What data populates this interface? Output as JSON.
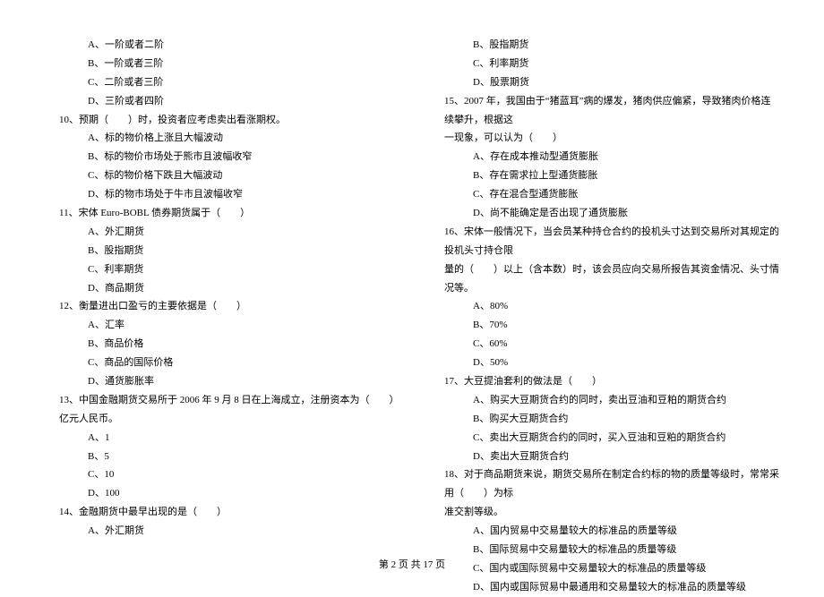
{
  "left": {
    "q9_opts": {
      "A": "A、一阶或者二阶",
      "B": "B、一阶或者三阶",
      "C": "C、二阶或者三阶",
      "D": "D、三阶或者四阶"
    },
    "q10": "10、预期（　　）时，投资者应考虑卖出看涨期权。",
    "q10_opts": {
      "A": "A、标的物价格上涨且大幅波动",
      "B": "B、标的物价市场处于熊市且波幅收窄",
      "C": "C、标的物价格下跌且大幅波动",
      "D": "D、标的物市场处于牛市且波幅收窄"
    },
    "q11": "11、宋体 Euro-BOBL 债券期货属于（　　）",
    "q11_opts": {
      "A": "A、外汇期货",
      "B": "B、股指期货",
      "C": "C、利率期货",
      "D": "D、商品期货"
    },
    "q12": "12、衡量进出口盈亏的主要依据是（　　）",
    "q12_opts": {
      "A": "A、汇率",
      "B": "B、商品价格",
      "C": "C、商品的国际价格",
      "D": "D、通货膨胀率"
    },
    "q13": "13、中国金融期货交易所于 2006 年 9 月 8 日在上海成立，注册资本为（　　）亿元人民币。",
    "q13_opts": {
      "A": "A、1",
      "B": "B、5",
      "C": "C、10",
      "D": "D、100"
    },
    "q14": "14、金融期货中最早出现的是（　　）",
    "q14_opts": {
      "A": "A、外汇期货"
    }
  },
  "right": {
    "q14_opts": {
      "B": "B、股指期货",
      "C": "C、利率期货",
      "D": "D、股票期货"
    },
    "q15": "15、2007 年，我国由于“猪蓝耳”病的爆发，猪肉供应偏紧，导致猪肉价格连续攀升，根据这",
    "q15b": "一现象，可以认为（　　）",
    "q15_opts": {
      "A": "A、存在成本推动型通货膨胀",
      "B": "B、存在需求拉上型通货膨胀",
      "C": "C、存在混合型通货膨胀",
      "D": "D、尚不能确定是否出现了通货膨胀"
    },
    "q16": "16、宋体一般情况下，当会员某种持仓合约的投机头寸达到交易所对其规定的投机头寸持仓限",
    "q16b": "量的（　　）以上（含本数）时，该会员应向交易所报告其资金情况、头寸情况等。",
    "q16_opts": {
      "A": "A、80%",
      "B": "B、70%",
      "C": "C、60%",
      "D": "D、50%"
    },
    "q17": "17、大豆提油套利的做法是（　　）",
    "q17_opts": {
      "A": "A、购买大豆期货合约的同时，卖出豆油和豆粕的期货合约",
      "B": "B、购买大豆期货合约",
      "C": "C、卖出大豆期货合约的同时，买入豆油和豆粕的期货合约",
      "D": "D、卖出大豆期货合约"
    },
    "q18": "18、对于商品期货来说，期货交易所在制定合约标的物的质量等级时，常常采用（　　）为标",
    "q18b": "准交割等级。",
    "q18_opts": {
      "A": "A、国内贸易中交易量较大的标准品的质量等级",
      "B": "B、国际贸易中交易量较大的标准品的质量等级",
      "C": "C、国内或国际贸易中交易量较大的标准品的质量等级",
      "D": "D、国内或国际贸易中最通用和交易量较大的标准品的质量等级"
    }
  },
  "footer": "第 2 页 共 17 页"
}
